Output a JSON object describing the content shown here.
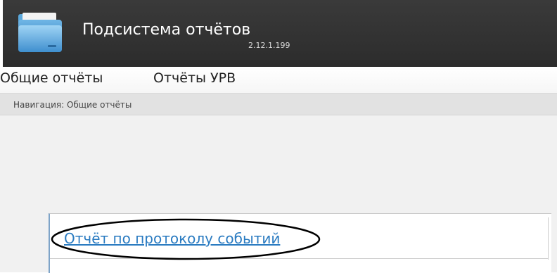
{
  "header": {
    "title": "Подсистема отчётов",
    "version": "2.12.1.199",
    "logo_icon": "folder-icon"
  },
  "menu": {
    "items": [
      {
        "label": "Общие отчёты"
      },
      {
        "label": "Отчёты УРВ"
      }
    ]
  },
  "breadcrumb": {
    "text": "Навигация: Общие отчёты"
  },
  "reports": {
    "items": [
      {
        "label": "Отчёт по протоколу событий"
      }
    ]
  },
  "colors": {
    "header_bg": "#333333",
    "link": "#2a7bc1",
    "panel_accent": "#7ea4c8",
    "highlight_oval": "#000000"
  }
}
